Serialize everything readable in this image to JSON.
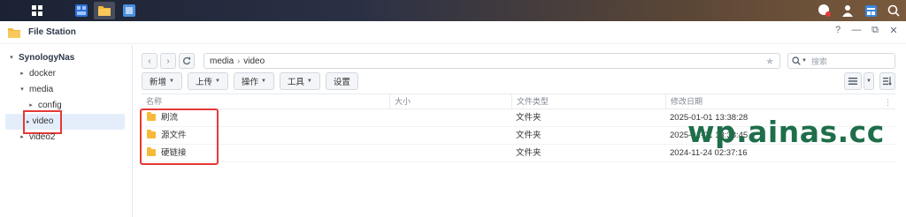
{
  "taskbar": {
    "icons": [
      "main-menu-icon",
      "control-panel-icon",
      "file-station-icon",
      "package-center-icon"
    ],
    "right_icons": [
      "notification-icon",
      "user-icon",
      "widgets-icon",
      "search-icon"
    ]
  },
  "window": {
    "title": "File Station",
    "controls": {
      "help": "?",
      "minimize": "—",
      "restore": "⧉",
      "close": "✕"
    }
  },
  "sidebar": {
    "root": "SynologyNas",
    "items": [
      {
        "label": "docker",
        "level": 1,
        "arrow": "▸"
      },
      {
        "label": "media",
        "level": 1,
        "arrow": "▾"
      },
      {
        "label": "config",
        "level": 2,
        "arrow": "▸"
      },
      {
        "label": "video",
        "level": 2,
        "arrow": "▸",
        "selected": true
      },
      {
        "label": "video2",
        "level": 1,
        "arrow": "▸"
      }
    ]
  },
  "nav": {
    "back": "‹",
    "forward": "›",
    "refresh": "C",
    "path": [
      "media",
      "video"
    ],
    "search_placeholder": "搜索"
  },
  "toolbar": {
    "create": "新增",
    "upload": "上传",
    "action": "操作",
    "tools": "工具",
    "settings": "设置"
  },
  "table": {
    "columns": [
      "名称",
      "大小",
      "文件类型",
      "修改日期"
    ],
    "rows": [
      {
        "name": "刷流",
        "size": "",
        "type": "文件夹",
        "modified": "2025-01-01 13:38:28"
      },
      {
        "name": "源文件",
        "size": "",
        "type": "文件夹",
        "modified": "2025-01-01 13:38:45"
      },
      {
        "name": "硬链接",
        "size": "",
        "type": "文件夹",
        "modified": "2024-11-24 02:37:16"
      }
    ]
  },
  "watermark": "wp.ainas.cc",
  "colors": {
    "accent": "#1e6e4a",
    "highlight": "#e53935",
    "folder": "#f6b93b",
    "selected_bg": "#e4eefb"
  }
}
